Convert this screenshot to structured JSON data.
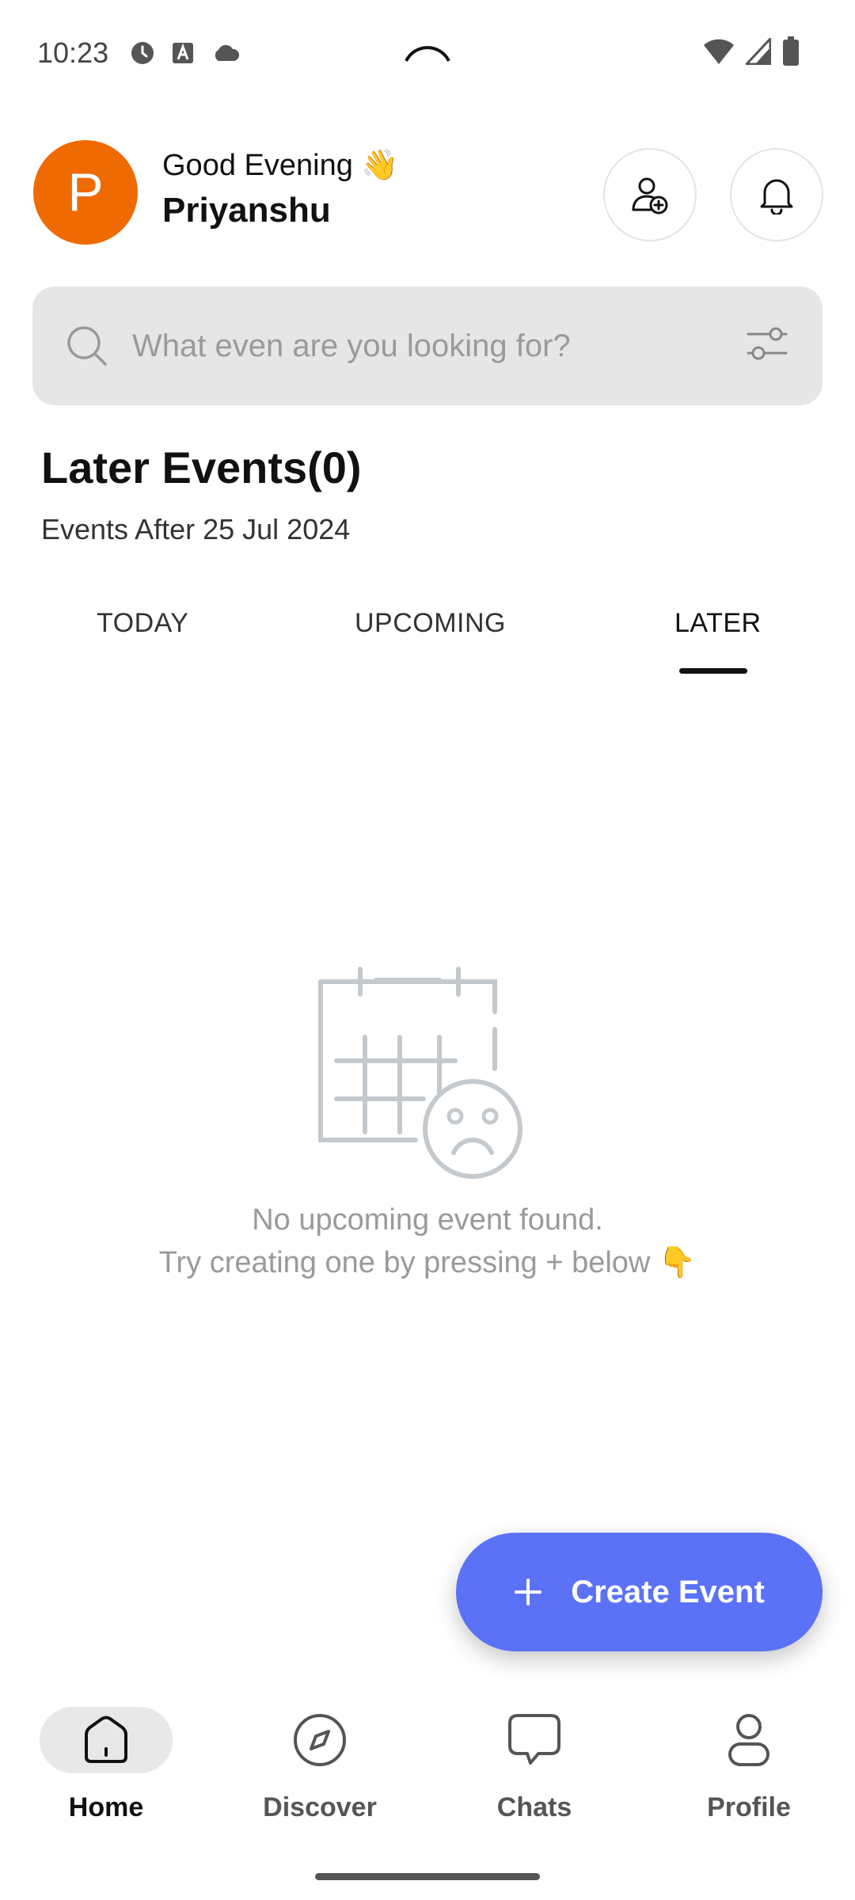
{
  "status_bar": {
    "time": "10:23",
    "icons_left": [
      "clock-icon",
      "a-icon",
      "cloud-icon"
    ],
    "icons_right": [
      "wifi-icon",
      "signal-icon",
      "battery-icon"
    ]
  },
  "header": {
    "avatar_initial": "P",
    "avatar_color": "#EF6A00",
    "greeting": "Good Evening 👋",
    "username": "Priyanshu"
  },
  "search": {
    "placeholder": "What even are you looking for?",
    "value": ""
  },
  "section": {
    "title": "Later Events(0)",
    "subtitle": "Events After 25 Jul 2024"
  },
  "tabs": [
    {
      "label": "TODAY",
      "active": false
    },
    {
      "label": "UPCOMING",
      "active": false
    },
    {
      "label": "LATER",
      "active": true
    }
  ],
  "empty_state": {
    "line1": "No upcoming event found.",
    "line2": "Try creating one by pressing + below 👇"
  },
  "fab": {
    "label": "Create Event",
    "color": "#5B72F7"
  },
  "bottom_nav": [
    {
      "label": "Home",
      "icon": "home-icon",
      "active": true
    },
    {
      "label": "Discover",
      "icon": "compass-icon",
      "active": false
    },
    {
      "label": "Chats",
      "icon": "chat-bubble-icon",
      "active": false
    },
    {
      "label": "Profile",
      "icon": "person-icon",
      "active": false
    }
  ]
}
